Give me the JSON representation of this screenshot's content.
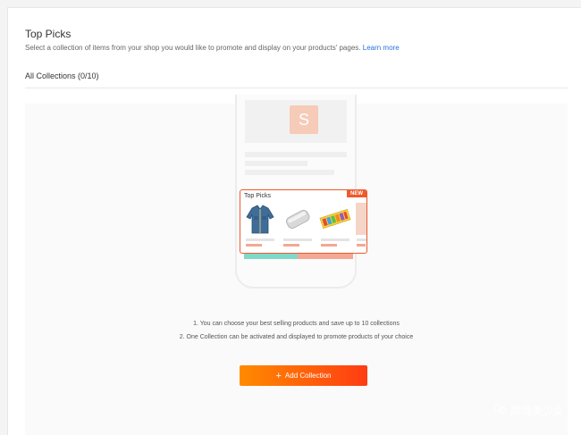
{
  "header": {
    "title": "Top Picks",
    "subtitle": "Select a collection of items from your shop you would like to promote and display on your products' pages.",
    "learn_more": "Learn more"
  },
  "collections": {
    "label": "All Collections (0/10)"
  },
  "illustration": {
    "logo_letter": "S",
    "card_title": "Top Picks",
    "badge": "NEW"
  },
  "instructions": [
    "1. You can choose your best selling products and save up to 10 collections",
    "2. One Collection can be activated and displayed to promote products of your choice"
  ],
  "actions": {
    "add_collection": "Add Collection"
  },
  "watermark": {
    "text": "跨境美少女",
    "icon": "wechat-icon"
  },
  "colors": {
    "accent": "#ee4d2d",
    "link": "#2673dd",
    "button_gradient_start": "#ff8a00",
    "button_gradient_end": "#ff3c13"
  }
}
